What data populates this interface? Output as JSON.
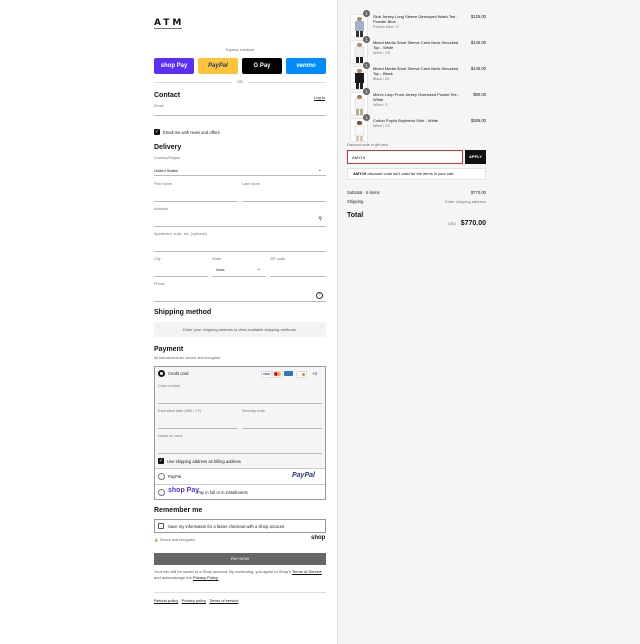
{
  "brand": {
    "logo": "ATM"
  },
  "express": {
    "title": "Express checkout",
    "shoppay": "shop Pay",
    "paypal": "PayPal",
    "gpay": "G Pay",
    "venmo": "venmo",
    "or": "OR"
  },
  "contact": {
    "title": "Contact",
    "login": "Log in",
    "email_label": "Email",
    "newsletter": "Email me with news and offers"
  },
  "delivery": {
    "title": "Delivery",
    "country_label": "Country/Region",
    "country_value": "United States",
    "first_name": "First name",
    "last_name": "Last name",
    "address": "Address",
    "apartment": "Apartment, suite, etc. (optional)",
    "city": "City",
    "state_label": "State",
    "state_value": "Iowa",
    "zip": "ZIP code",
    "phone": "Phone"
  },
  "shipping": {
    "title": "Shipping method",
    "message": "Enter your shipping address to view available shipping methods."
  },
  "payment": {
    "title": "Payment",
    "subtitle": "All transactions are secure and encrypted.",
    "credit_card": "Credit card",
    "more_cards": "+4",
    "card_number": "Card number",
    "expiration": "Expiration date (MM / YY)",
    "security": "Security code",
    "name_on_card": "Name on card",
    "billing_same": "Use shipping address as billing address",
    "paypal": "PayPal",
    "paypal_logo": "PayPal",
    "shoppay_logo": "shop Pay",
    "shoppay_text": "Pay in full or in installments"
  },
  "remember": {
    "title": "Remember me",
    "save": "Save my information for a faster checkout with a Shop account",
    "secure": "Secure and encrypted",
    "shop_logo": "shop"
  },
  "pay_now": "PAY NOW",
  "legal": {
    "text": "Your info will be saved to a Shop account. By continuing, you agree to Shop's",
    "terms": "Terms of Service",
    "and": "and acknowledge the",
    "privacy": "Privacy Policy."
  },
  "footer": {
    "refund": "Refund policy",
    "privacy": "Privacy policy",
    "terms": "Terms of service"
  },
  "cart": {
    "items": [
      {
        "qty": "1",
        "name": "Slub Jersey Long Sleeve Destroyed Wash Tee - Powder Blue",
        "variant": "Powder Blue / S",
        "price": "$125.00"
      },
      {
        "qty": "1",
        "name": "Mixed Media Short Sleeve Crew Neck Smocked Top - White",
        "variant": "White / XS",
        "price": "$145.00"
      },
      {
        "qty": "1",
        "name": "Mixed Media Short Sleeve Crew Neck Smocked Top - Black",
        "variant": "Black / XS",
        "price": "$145.00"
      },
      {
        "qty": "1",
        "name": "Men's Loop Front Jersey Oversized Pocket Tee - White",
        "variant": "White / S",
        "price": "$90.00"
      },
      {
        "qty": "1",
        "name": "Cotton Poplin Boyfriend Shirt - White",
        "variant": "White / XS",
        "price": "$265.00"
      }
    ],
    "discount_label": "Discount code or gift card",
    "discount_value": "AMY15",
    "apply": "APPLY",
    "error_code": "AMY15",
    "error_text": "discount code isn't valid for the items in your cart",
    "subtotal_label": "Subtotal · 5 items",
    "subtotal_value": "$770.00",
    "shipping_label": "Shipping",
    "shipping_value": "Enter shipping address",
    "total_label": "Total",
    "currency": "USD",
    "total_value": "$770.00"
  },
  "colors": {
    "shoppay": "#5a31f4",
    "paypal": "#ffc439",
    "venmo": "#008cff",
    "gpay": "#000000"
  }
}
